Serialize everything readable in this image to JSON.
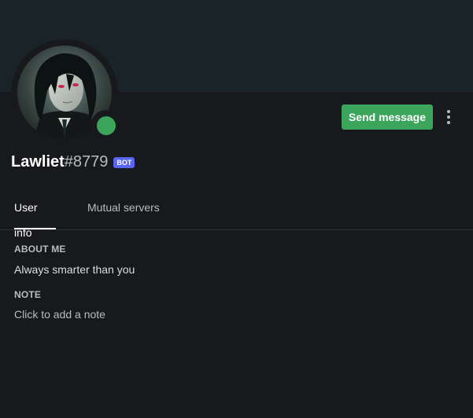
{
  "profile": {
    "username": "Lawliet",
    "discriminator": "#8779",
    "bot_tag": "BOT",
    "status": "online",
    "status_color": "#3ba55c",
    "banner_color": "#1a2328"
  },
  "actions": {
    "send_message_label": "Send message",
    "more_icon": "more-vertical-icon"
  },
  "tabs": [
    {
      "label": "User info",
      "active": true
    },
    {
      "label": "Mutual servers",
      "active": false
    }
  ],
  "about": {
    "title": "ABOUT ME",
    "text": "Always smarter than you"
  },
  "note": {
    "title": "NOTE",
    "placeholder": "Click to add a note",
    "value": ""
  },
  "colors": {
    "accent_green": "#3ba55c",
    "bot_blurple": "#5865f2",
    "background": "#18191c"
  }
}
